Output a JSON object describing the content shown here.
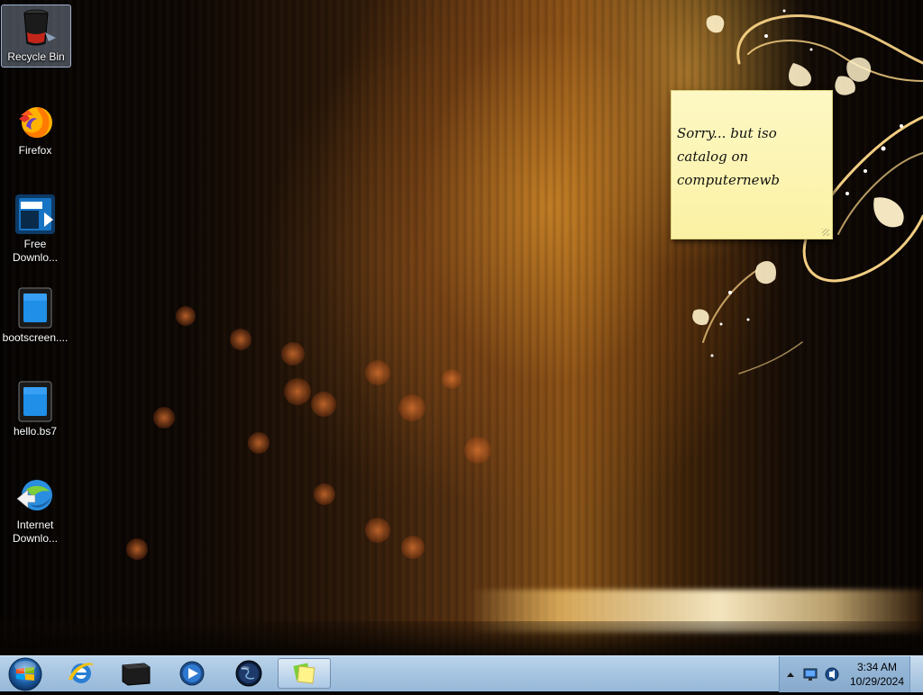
{
  "desktop": {
    "icons": [
      {
        "label": "Recycle Bin",
        "icon": "recycle-bin-icon",
        "selected": true
      },
      {
        "label": "Firefox",
        "icon": "firefox-icon"
      },
      {
        "label": "Free Downlo...",
        "icon": "free-download-manager-icon"
      },
      {
        "label": "bootscreen....",
        "icon": "document-file-icon"
      },
      {
        "label": "hello.bs7",
        "icon": "document-file-icon"
      },
      {
        "label": "Internet Downlo...",
        "icon": "internet-download-manager-icon"
      }
    ]
  },
  "sticky_note": {
    "lines": [
      "Sorry... but iso",
      "catalog on",
      "computernewb"
    ]
  },
  "taskbar": {
    "start": "start-orb",
    "pinned": [
      {
        "name": "internet-explorer",
        "icon": "internet-explorer-icon"
      },
      {
        "name": "command-prompt",
        "icon": "terminal-icon"
      },
      {
        "name": "media-player",
        "icon": "media-player-icon"
      },
      {
        "name": "globe",
        "icon": "globe-icon"
      },
      {
        "name": "sticky-notes",
        "icon": "sticky-notes-icon",
        "active": true
      }
    ],
    "tray": {
      "time": "3:34 AM",
      "date": "10/29/2024",
      "icons": [
        "show-hidden-icons-arrow",
        "network-icon",
        "volume-icon"
      ]
    }
  },
  "colors": {
    "taskbar": "#a8c6e2",
    "sticky": "#fbf1a4"
  }
}
